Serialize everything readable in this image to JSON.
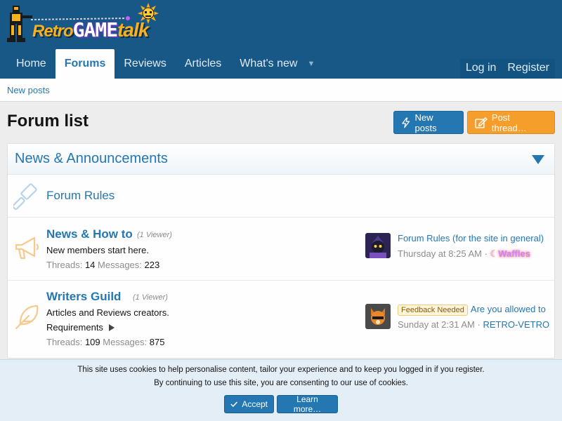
{
  "header": {
    "logo_text": {
      "retro": "Retro",
      "game": "GAME",
      "talk": "talk"
    },
    "nav_tabs": [
      {
        "label": "Home"
      },
      {
        "label": "Forums"
      },
      {
        "label": "Reviews"
      },
      {
        "label": "Articles"
      },
      {
        "label": "What's new"
      }
    ],
    "login": "Log in",
    "register": "Register"
  },
  "subnav": {
    "new_posts": "New posts"
  },
  "page": {
    "title": "Forum list",
    "new_posts_button": "New posts",
    "post_thread_button": "Post thread…"
  },
  "category": {
    "title": "News & Announcements",
    "forums": [
      {
        "title": "Forum Rules"
      },
      {
        "title": "News & How to",
        "viewers": "(1 Viewer)",
        "description": "New members start here.",
        "threads_label": "Threads:",
        "threads": "14",
        "messages_label": "Messages:",
        "messages": "223",
        "latest": {
          "title": "Forum Rules (for the site in general)",
          "date": "Thursday at 8:25 AM",
          "sep": "·",
          "user": "Waffles"
        }
      },
      {
        "title": "Writers Guild",
        "viewers": "(1 Viewer)",
        "description": "Articles and Reviews creators.",
        "subforum": "Requirements",
        "threads_label": "Threads:",
        "threads": "109",
        "messages_label": "Messages:",
        "messages": "875",
        "latest": {
          "prefix": "Feedback Needed",
          "title": "Are you allowed to",
          "date": "Sunday at 2:31 AM",
          "sep": "·",
          "user": "RETRO-VETRO"
        }
      }
    ]
  },
  "cookie": {
    "line1": "This site uses cookies to help personalise content, tailor your experience and to keep you logged in if you register.",
    "line2": "By continuing to use this site, you are consenting to our use of cookies.",
    "accept": "Accept",
    "learn_more": "Learn more…"
  },
  "colors": {
    "header_bg": "#185886",
    "link": "#2577b1",
    "accent_orange": "#f59e2b"
  }
}
